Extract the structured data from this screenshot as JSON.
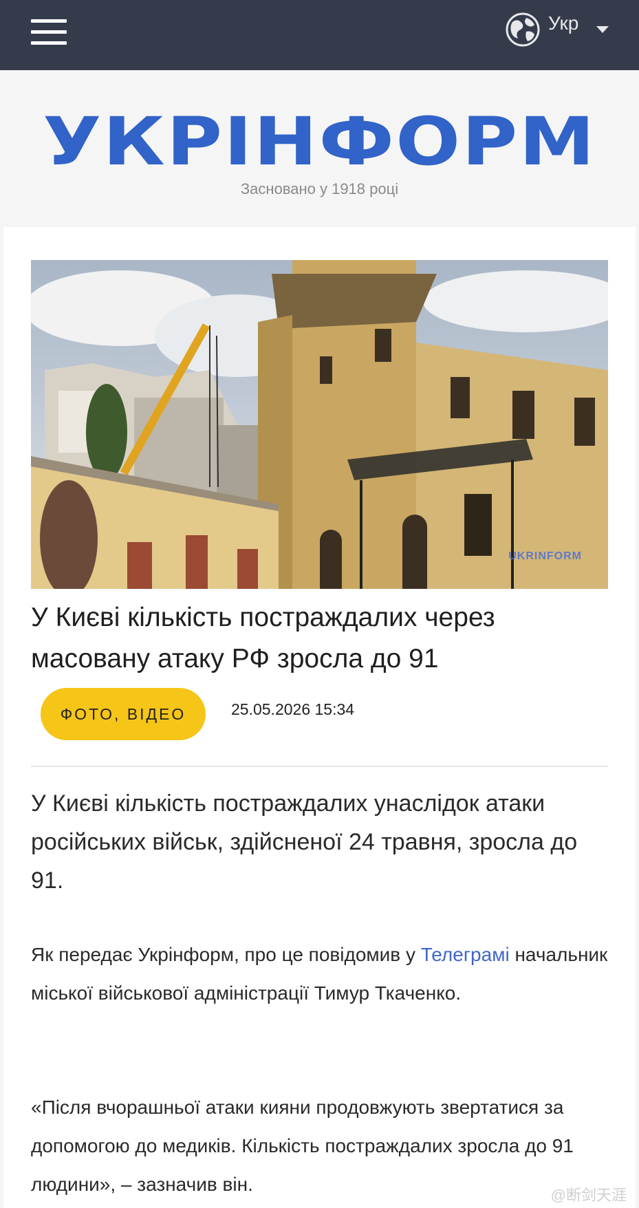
{
  "header": {
    "menu_icon": "hamburger-menu-icon",
    "language": {
      "label": "Укр",
      "icon": "globe-icon",
      "dropdown_icon": "caret-down-icon"
    }
  },
  "brand": {
    "logo_text": "УКРІНФОРМ",
    "tagline": "Засновано у 1918 році",
    "color": "#3163c8"
  },
  "article": {
    "image_watermark": "UKRINFORM",
    "title": "У Києві кількість постраждалих через масовану атаку РФ зросла до 91",
    "tag": "ФОТО, ВІДЕО",
    "tag_color": "#f5c518",
    "date": "25.05.2026 15:34",
    "lead": "У Києві кількість постраждалих унаслідок атаки російських військ, здійсненої 24 травня, зросла до 91.",
    "p1_before": "Як передає Укрінформ, про це повідомив у ",
    "p1_link": "Телеграмі",
    "p1_after": " начальник міської військової адміністрації Тимур Ткаченко.",
    "p2": "«Після вчорашньої атаки кияни продовжують звертатися за допомогою до медиків. Кількість постраждалих зросла до 91 людини», – зазначив він."
  },
  "overlay": {
    "weibo_watermark": "@断剑天涯"
  }
}
